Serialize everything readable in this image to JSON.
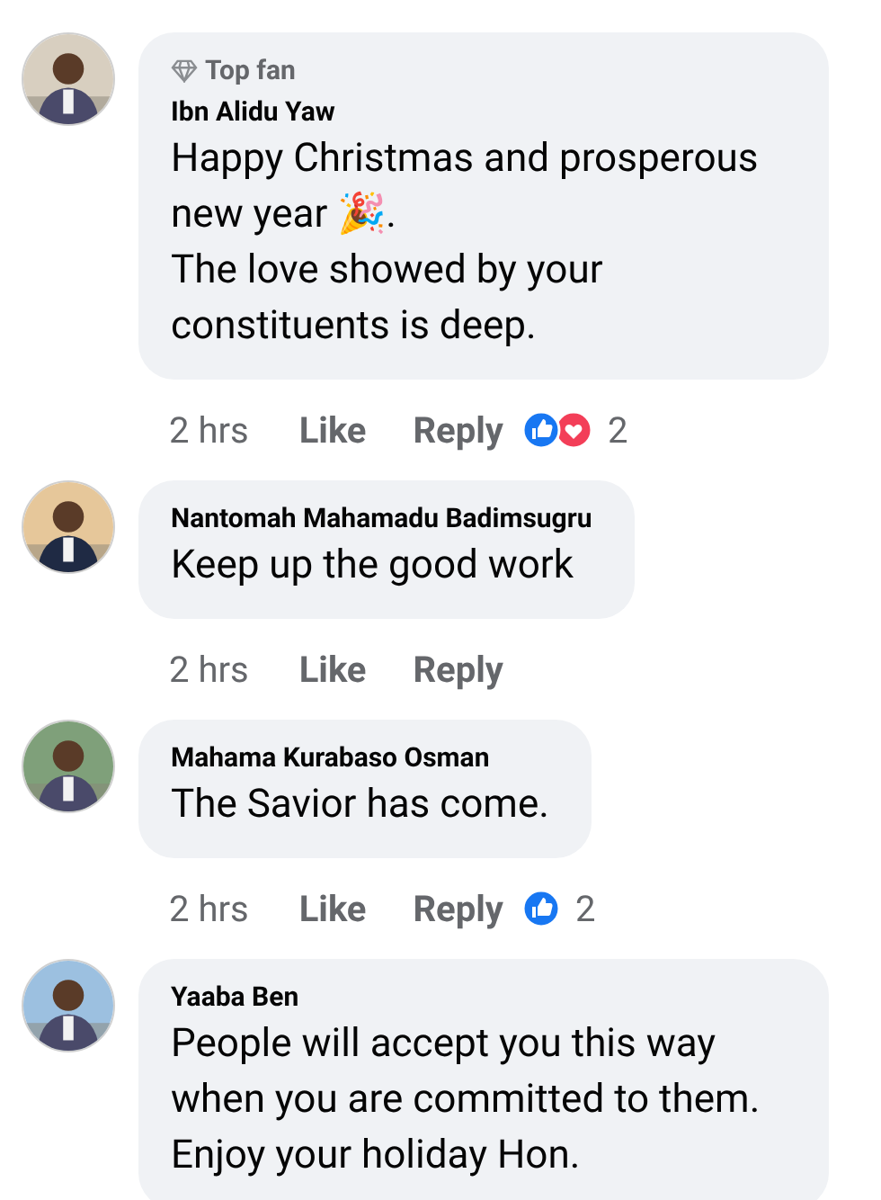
{
  "comments": [
    {
      "avatar": {
        "kind": "picture"
      },
      "badge": "Top fan",
      "author": "Ibn Alidu Yaw",
      "text": "Happy Christmas and prosperous new year 🎉.\nThe love showed by your constituents is deep.",
      "time": "2 hrs",
      "like": "Like",
      "reply": "Reply",
      "reactions": [
        {
          "kind": "like"
        },
        {
          "kind": "love"
        }
      ],
      "reaction_count": "2"
    },
    {
      "avatar": {
        "kind": "picture"
      },
      "author": "Nantomah Mahamadu Badimsugru",
      "text": "Keep up the good work",
      "time": "2 hrs",
      "like": "Like",
      "reply": "Reply"
    },
    {
      "avatar": {
        "kind": "picture"
      },
      "author": "Mahama Kurabaso Osman",
      "text": "The Savior has come.",
      "time": "2 hrs",
      "like": "Like",
      "reply": "Reply",
      "reactions": [
        {
          "kind": "like"
        }
      ],
      "reaction_count": "2"
    },
    {
      "avatar": {
        "kind": "picture"
      },
      "author": "Yaaba Ben",
      "text": "People will accept you this way when you are committed to them. Enjoy your holiday Hon."
    }
  ]
}
